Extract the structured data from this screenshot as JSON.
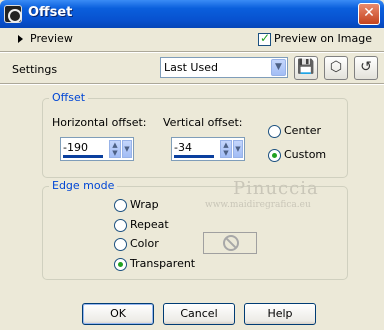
{
  "window": {
    "title": "Offset",
    "close_symbol": "✕"
  },
  "preview": {
    "label": "Preview",
    "on_image_label": "Preview on Image",
    "on_image_checked": true
  },
  "settings": {
    "label": "Settings",
    "preset_value": "Last Used"
  },
  "offset_group": {
    "legend": "Offset",
    "horizontal_label": "Horizontal offset:",
    "horizontal_value": "-190",
    "vertical_label": "Vertical offset:",
    "vertical_value": "-34",
    "center_label": "Center",
    "custom_label": "Custom",
    "selected": "Custom"
  },
  "edge_group": {
    "legend": "Edge mode",
    "options": [
      "Wrap",
      "Repeat",
      "Color",
      "Transparent"
    ],
    "selected": "Transparent"
  },
  "watermark": {
    "name": "Pinuccia",
    "url": "www.maidiregrafica.eu"
  },
  "buttons": {
    "ok": "OK",
    "cancel": "Cancel",
    "help": "Help"
  },
  "icons": [
    "app-icon",
    "save-preset-icon",
    "box-preset-icon",
    "reset-preset-icon",
    "no-color-icon"
  ]
}
